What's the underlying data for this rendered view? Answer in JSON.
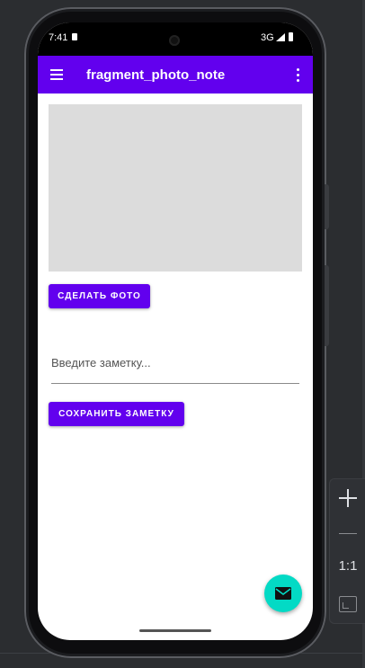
{
  "status_bar": {
    "time": "7:41",
    "network": "3G"
  },
  "app_bar": {
    "title": "fragment_photo_note",
    "menu_icon": "menu-icon",
    "overflow_icon": "more-vert-icon",
    "color": "#6200ee"
  },
  "photo": {
    "placeholder_color": "#dcdcdc"
  },
  "buttons": {
    "take_photo": "СДЕЛАТЬ ФОТО",
    "save_note": "СОХРАНИТЬ ЗАМЕТКУ"
  },
  "note_input": {
    "value": "",
    "placeholder": "Введите заметку..."
  },
  "fab": {
    "icon": "mail-icon",
    "color": "#03dac5"
  },
  "zoom_panel": {
    "zoom_in": "+",
    "reset_label": "1:1",
    "fit_icon": "fit-screen-icon"
  }
}
